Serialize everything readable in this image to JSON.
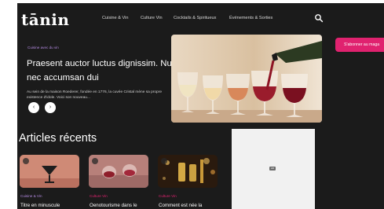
{
  "header": {
    "logo": "tānin",
    "nav": [
      {
        "label": "Cuisine & Vin"
      },
      {
        "label": "Culture Vin"
      },
      {
        "label": "Cocktails & Spiritueux"
      },
      {
        "label": "Événements & Sorties"
      }
    ],
    "search_icon": "search-icon",
    "subscribe_label": "S'abonner au maga"
  },
  "hero": {
    "category": "Cuisine avec du vin",
    "title": "Praesent auctor luctus dignissim. Nunc nec accumsan dui",
    "excerpt": "Au sein de la maison Roederer, fondée en 1776, la cuvée Cristal mène sa propre existence d'idole. Voici son nouveau...",
    "prev_icon": "‹",
    "next_icon": "›"
  },
  "recent": {
    "title": "Articles récents",
    "cards": [
      {
        "category": "Cuisine & Vin",
        "category_color": "#b38ae0",
        "title": "Titre en minuscule"
      },
      {
        "category": "Culture Vin",
        "category_color": "#e0226f",
        "title": "Oenotourisme dans le"
      },
      {
        "category": "Culture Vin",
        "category_color": "#e0226f",
        "title": "Comment est née la"
      }
    ]
  },
  "ad": {
    "mark": "AD"
  },
  "colors": {
    "background": "#1b1b1b",
    "accent": "#e0226f",
    "category_purple": "#b38ae0"
  }
}
